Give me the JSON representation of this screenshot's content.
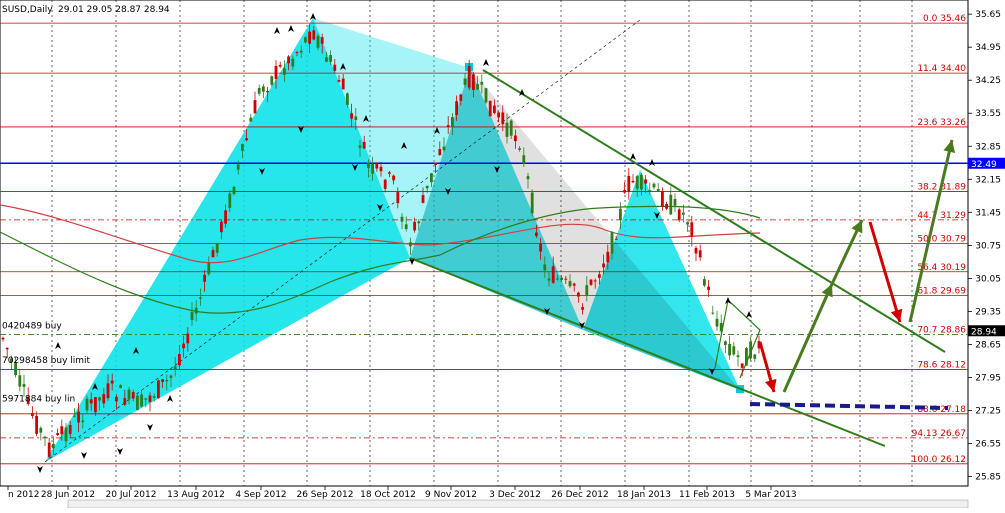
{
  "header": {
    "title": "SUSD,Daily",
    "ohlc": "29.01 29.05 28.87 28.94"
  },
  "colors": {
    "fib_line": "#d00000",
    "fib_label": "#d00000",
    "resistance_line": "#0000ff",
    "price_axis_bg": "#ffffff",
    "channel": "#2e7d1a",
    "wedge": "#00e0e8",
    "bull_candle": "#2e7d1a",
    "bear_candle": "#d00000",
    "ma_red": "#d04040",
    "ma_green": "#2e7d1a",
    "arrow_up": "#4a7a1e",
    "arrow_down": "#d00000",
    "target_dash": "#1a1a8c"
  },
  "fib_levels": [
    {
      "label": "0.0 35.46",
      "price": 35.46
    },
    {
      "label": "11.4 34.40",
      "price": 34.4
    },
    {
      "label": "23.6 33.26",
      "price": 33.26
    },
    {
      "label": "38.2 31.89",
      "price": 31.89
    },
    {
      "label": "44.7 31.29",
      "price": 31.29
    },
    {
      "label": "50.0 30.79",
      "price": 30.79
    },
    {
      "label": "56.4 30.19",
      "price": 30.19
    },
    {
      "label": "61.8 29.69",
      "price": 29.69
    },
    {
      "label": "70.7 28.86",
      "price": 28.86
    },
    {
      "label": "78.6 28.12",
      "price": 28.12
    },
    {
      "label": "88.6 27.18",
      "price": 27.18
    },
    {
      "label": "94.13 26.67",
      "price": 26.67
    },
    {
      "label": "100.0 26.12",
      "price": 26.12
    }
  ],
  "resistance": {
    "label": "32.49",
    "price": 32.49
  },
  "current_price": {
    "label": "28.94",
    "price": 28.94
  },
  "price_ticks": [
    "35.65",
    "34.95",
    "34.25",
    "33.55",
    "32.85",
    "32.15",
    "31.45",
    "30.75",
    "30.05",
    "29.35",
    "28.65",
    "27.95",
    "27.25",
    "26.55",
    "25.85"
  ],
  "date_ticks": [
    "n 2012",
    "28 Jun 2012",
    "20 Jul 2012",
    "13 Aug 2012",
    "4 Sep 2012",
    "26 Sep 2012",
    "18 Oct 2012",
    "9 Nov 2012",
    "3 Dec 2012",
    "26 Dec 2012",
    "18 Jan 2013",
    "11 Feb 2013",
    "5 Mar 2013"
  ],
  "order_labels": [
    {
      "text": "0420489 buy",
      "price": 29.05
    },
    {
      "text": "70298458 buy limit",
      "price": 28.32
    },
    {
      "text": "5971884 buy lin",
      "price": 27.5
    }
  ],
  "chart_data": {
    "type": "candlestick",
    "title": "",
    "ylim": [
      25.65,
      35.95
    ],
    "x_range": [
      "2012-06-07",
      "2013-04-12"
    ],
    "notes": "Gartley/bat harmonic pattern shaded cyan; descending green channel; projected arrows toward fib levels"
  }
}
